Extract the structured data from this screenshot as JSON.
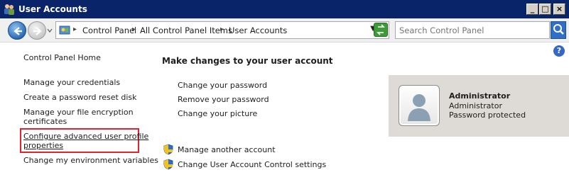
{
  "window": {
    "title": "User Accounts",
    "icon": "users-icon"
  },
  "navigation": {
    "breadcrumbs": [
      "Control Panel",
      "All Control Panel Items",
      "User Accounts"
    ],
    "search_placeholder": "Search Control Panel"
  },
  "sidebar": {
    "items": [
      {
        "label": "Control Panel Home"
      },
      {
        "label": "Manage your credentials"
      },
      {
        "label": "Create a password reset disk"
      },
      {
        "label": "Manage your file encryption"
      },
      {
        "label": "certificates"
      },
      {
        "label": "Configure advanced user profile"
      },
      {
        "label": "properties"
      },
      {
        "label": "Change my environment variables"
      }
    ]
  },
  "main": {
    "heading": "Make changes to your user account",
    "tasks": [
      {
        "label": "Change your password"
      },
      {
        "label": "Remove your password"
      },
      {
        "label": "Change your picture"
      }
    ],
    "shield_tasks": [
      {
        "label": "Manage another account"
      },
      {
        "label": "Change User Account Control settings"
      }
    ]
  },
  "account": {
    "name": "Administrator",
    "type": "Administrator",
    "status": "Password protected"
  },
  "colors": {
    "title_bar": "#0a246a",
    "highlight": "#e0232d",
    "card_bg": "#dedbd6"
  }
}
